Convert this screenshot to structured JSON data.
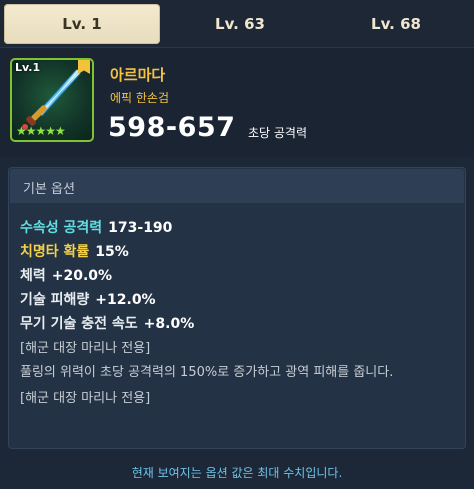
{
  "tabs": [
    {
      "label": "Lv. 1",
      "active": true
    },
    {
      "label": "Lv. 63",
      "active": false
    },
    {
      "label": "Lv. 68",
      "active": false
    }
  ],
  "item": {
    "level_badge": "Lv.1",
    "name": "아르마다",
    "grade": "에픽 한손검",
    "attack_range": "598-657",
    "attack_label": "초당 공격력",
    "stars": "★★★★★",
    "star_count": 5,
    "icon": "sword-icon"
  },
  "options": {
    "title": "기본 옵션",
    "stats": [
      {
        "label": "수속성 공격력",
        "value": "173-190",
        "color": "#5fe0e3"
      },
      {
        "label": "치명타 확률",
        "value": "15%",
        "color": "#f4d14a"
      },
      {
        "label": "체력",
        "value": "+20.0%",
        "color": "#e8edf2"
      },
      {
        "label": "기술 피해량",
        "value": "+12.0%",
        "color": "#e8edf2"
      },
      {
        "label": "무기 기술 충전 속도",
        "value": "+8.0%",
        "color": "#e8edf2"
      }
    ],
    "desc_1": "[해군 대장 마리나 전용]",
    "desc_2": "풀링의 위력이 초당 공격력의 150%로 증가하고 광역 피해를 줍니다.",
    "desc_3": "[해군 대장 마리나 전용]"
  },
  "footer": "현재 보여지는 옵션 값은 최대 수치입니다.",
  "colors": {
    "accent_gold": "#f6c33d",
    "tab_active_bg": "#f4eacf",
    "rarity_border": "#7fc332",
    "footer_text": "#6fc3e8"
  }
}
